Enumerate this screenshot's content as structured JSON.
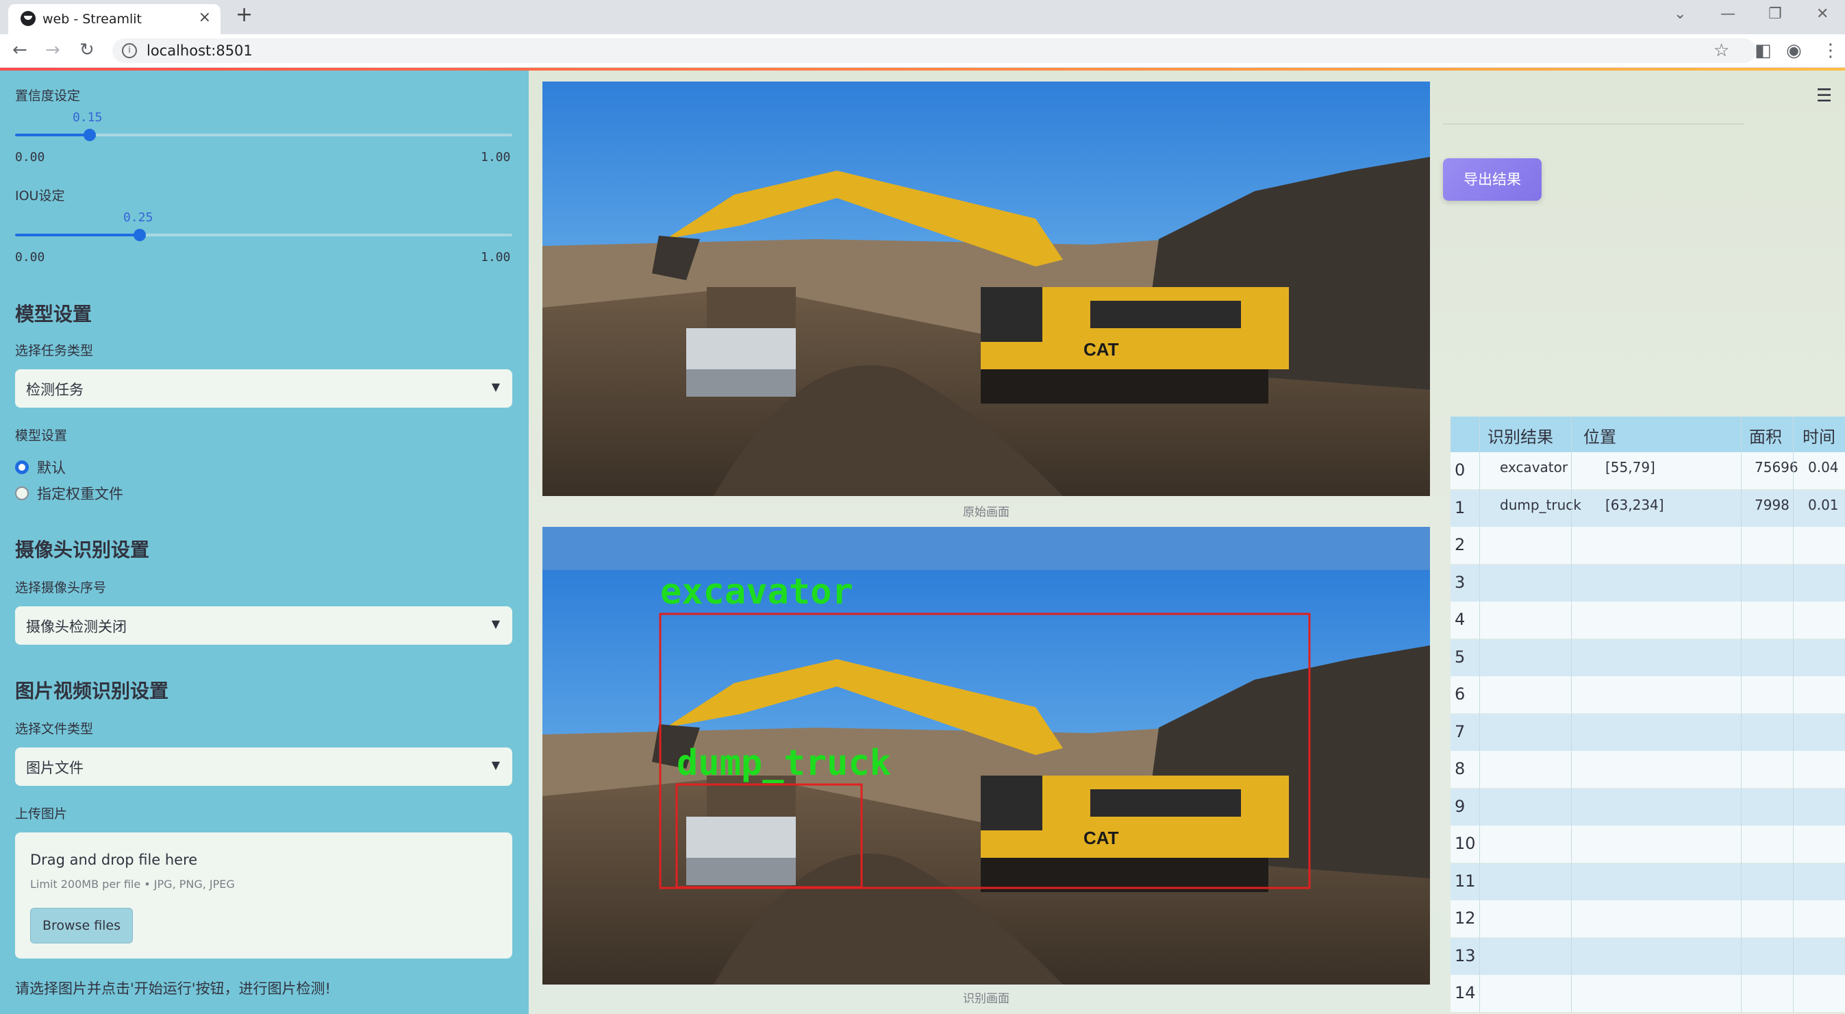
{
  "browser": {
    "tab_title": "web - Streamlit",
    "url": "localhost:8501"
  },
  "sidebar": {
    "confidence": {
      "label": "置信度设定",
      "value": "0.15",
      "min": "0.00",
      "max": "1.00",
      "fraction": 0.15
    },
    "iou": {
      "label": "IOU设定",
      "value": "0.25",
      "min": "0.00",
      "max": "1.00",
      "fraction": 0.25
    },
    "model_heading": "模型设置",
    "task_label": "选择任务类型",
    "task_value": "检测任务",
    "model_label": "模型设置",
    "model_options": [
      "默认",
      "指定权重文件"
    ],
    "model_selected": "默认",
    "camera_heading": "摄像头识别设置",
    "camera_label": "选择摄像头序号",
    "camera_value": "摄像头检测关闭",
    "file_heading": "图片视频识别设置",
    "file_type_label": "选择文件类型",
    "file_type_value": "图片文件",
    "upload_label": "上传图片",
    "upload_title": "Drag and drop file here",
    "upload_limit": "Limit 200MB per file • JPG, PNG, JPEG",
    "browse_label": "Browse files",
    "note": "请选择图片并点击'开始运行'按钮，进行图片检测!"
  },
  "main": {
    "original_caption": "原始画面",
    "result_caption": "识别画面",
    "detections": [
      {
        "label": "excavator",
        "color": "#1edc1e",
        "box_color": "#e02020"
      },
      {
        "label": "dump_truck",
        "color": "#1edc1e",
        "box_color": "#e02020"
      }
    ],
    "export_label": "导出结果",
    "table": {
      "headers": [
        "",
        "识别结果",
        "位置",
        "面积",
        "时间"
      ],
      "rows": [
        [
          "0",
          "excavator",
          "[55,79]",
          "75696",
          "0.04"
        ],
        [
          "1",
          "dump_truck",
          "[63,234]",
          "7998",
          "0.01"
        ],
        [
          "2",
          "",
          "",
          "",
          ""
        ],
        [
          "3",
          "",
          "",
          "",
          ""
        ],
        [
          "4",
          "",
          "",
          "",
          ""
        ],
        [
          "5",
          "",
          "",
          "",
          ""
        ],
        [
          "6",
          "",
          "",
          "",
          ""
        ],
        [
          "7",
          "",
          "",
          "",
          ""
        ],
        [
          "8",
          "",
          "",
          "",
          ""
        ],
        [
          "9",
          "",
          "",
          "",
          ""
        ],
        [
          "10",
          "",
          "",
          "",
          ""
        ],
        [
          "11",
          "",
          "",
          "",
          ""
        ],
        [
          "12",
          "",
          "",
          "",
          ""
        ],
        [
          "13",
          "",
          "",
          "",
          ""
        ],
        [
          "14",
          "",
          "",
          "",
          ""
        ]
      ]
    }
  }
}
